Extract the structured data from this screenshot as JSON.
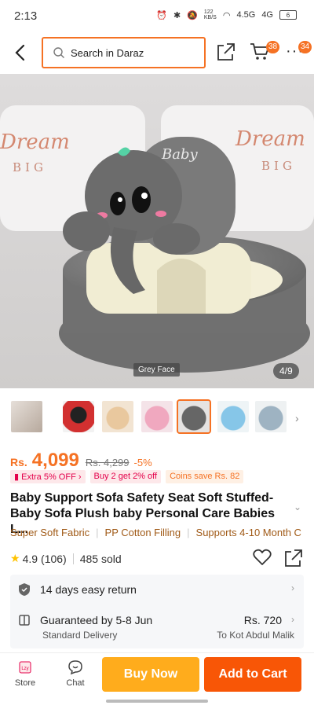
{
  "status_bar": {
    "time": "2:13",
    "network_speed": "122\nKB/S",
    "network_type": "4.5G",
    "lte": "4G",
    "battery": "6"
  },
  "header": {
    "search_placeholder": "Search in Daraz",
    "cart_count": "38",
    "more_count": "34"
  },
  "hero": {
    "variant_label": "Grey Face",
    "counter": "4/9",
    "pillow_text": "Dream",
    "pillow_subtext": "BIG",
    "sofa_text": "Baby"
  },
  "price": {
    "currency": "Rs.",
    "current": "4,099",
    "old": "Rs. 4,299",
    "discount": "-5%"
  },
  "promos": [
    {
      "text": "Extra 5% OFF ›"
    },
    {
      "text": "Buy 2 get 2% off"
    },
    {
      "text": "Coins save Rs. 82"
    }
  ],
  "product": {
    "title": "Baby Support Sofa Safety Seat Soft Stuffed-Baby Sofa Plush baby Personal Care Babies L...",
    "tags": [
      "Super Soft Fabric",
      "PP Cotton Filling",
      "Supports 4-10 Month C"
    ],
    "rating": "4.9",
    "reviews": "(106)",
    "sold": "485 sold"
  },
  "service": {
    "return_text": "14 days easy return",
    "delivery_text": "Guaranteed by 5-8 Jun",
    "delivery_sub": "Standard Delivery",
    "delivery_price": "Rs. 720",
    "delivery_to": "To Kot Abdul Malik"
  },
  "bottom_bar": {
    "store": "Store",
    "chat": "Chat",
    "buy_now": "Buy Now",
    "add_to_cart": "Add to Cart"
  },
  "colors": {
    "accent": "#f57224",
    "buy_now": "#ffac1c",
    "add_to_cart": "#f85606"
  }
}
